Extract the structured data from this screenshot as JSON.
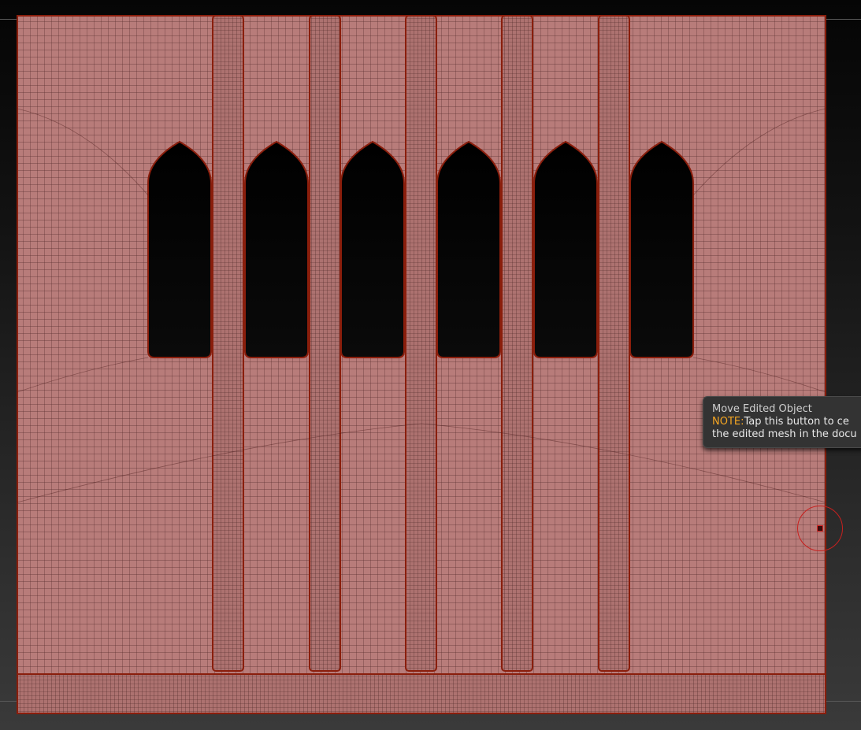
{
  "tooltip": {
    "title": "Move Edited Object",
    "note_label": "NOTE:",
    "line1": "Tap this button to ce",
    "line2": "the edited mesh in the docu"
  },
  "colors": {
    "mesh_fill": "#b87c7a",
    "mesh_edge": "#8a1e0c",
    "wire": "#2a1010",
    "window_hole": "#050505",
    "tooltip_bg": "#333333",
    "tooltip_note": "#f5a623",
    "brush_cursor": "#c8201e"
  },
  "icons": {
    "brush": "brush-cursor-icon"
  }
}
